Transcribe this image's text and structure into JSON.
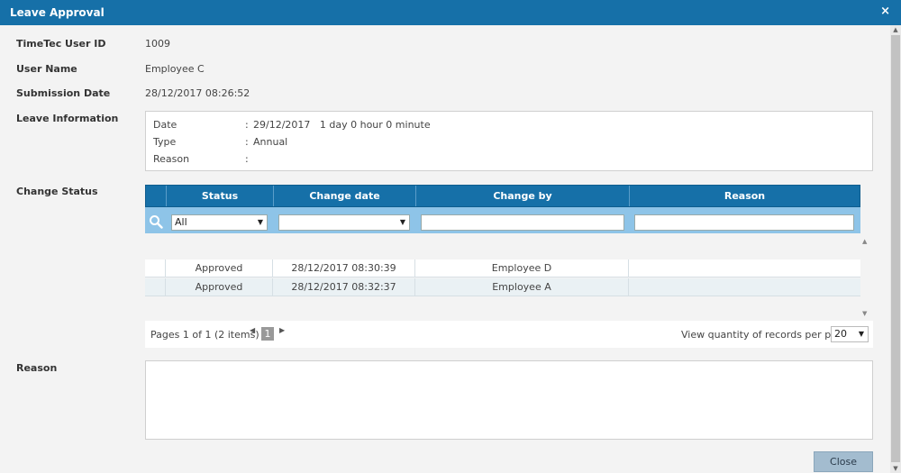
{
  "window": {
    "title": "Leave Approval",
    "close_glyph": "×"
  },
  "fields": {
    "user_id_label": "TimeTec User ID",
    "user_id_value": "1009",
    "user_name_label": "User Name",
    "user_name_value": "Employee C",
    "submission_label": "Submission Date",
    "submission_value": "28/12/2017 08:26:52",
    "leave_info_label": "Leave Information",
    "change_status_label": "Change Status",
    "reason_label": "Reason"
  },
  "leave_info": {
    "rows": [
      {
        "key": "Date",
        "sep": ":",
        "value": "29/12/2017   1 day 0 hour 0 minute"
      },
      {
        "key": "Type",
        "sep": ":",
        "value": "Annual"
      },
      {
        "key": "Reason",
        "sep": ":",
        "value": ""
      }
    ]
  },
  "grid": {
    "headers": [
      "Status",
      "Change date",
      "Change by",
      "Reason"
    ],
    "filter": {
      "status_selected": "All"
    },
    "rows": [
      {
        "status": "Approved",
        "date": "28/12/2017 08:30:39",
        "by": "Employee D",
        "reason": ""
      },
      {
        "status": "Approved",
        "date": "28/12/2017 08:32:37",
        "by": "Employee A",
        "reason": ""
      }
    ]
  },
  "pager": {
    "info": "Pages 1 of 1 (2 items)",
    "current_page": "1",
    "quantity_label": "View quantity of records per page",
    "quantity_value": "20"
  },
  "buttons": {
    "close_label": "Close"
  },
  "colors": {
    "accent": "#1670a8",
    "filter_bar": "#8ec4e8",
    "button": "#a3bccf"
  }
}
